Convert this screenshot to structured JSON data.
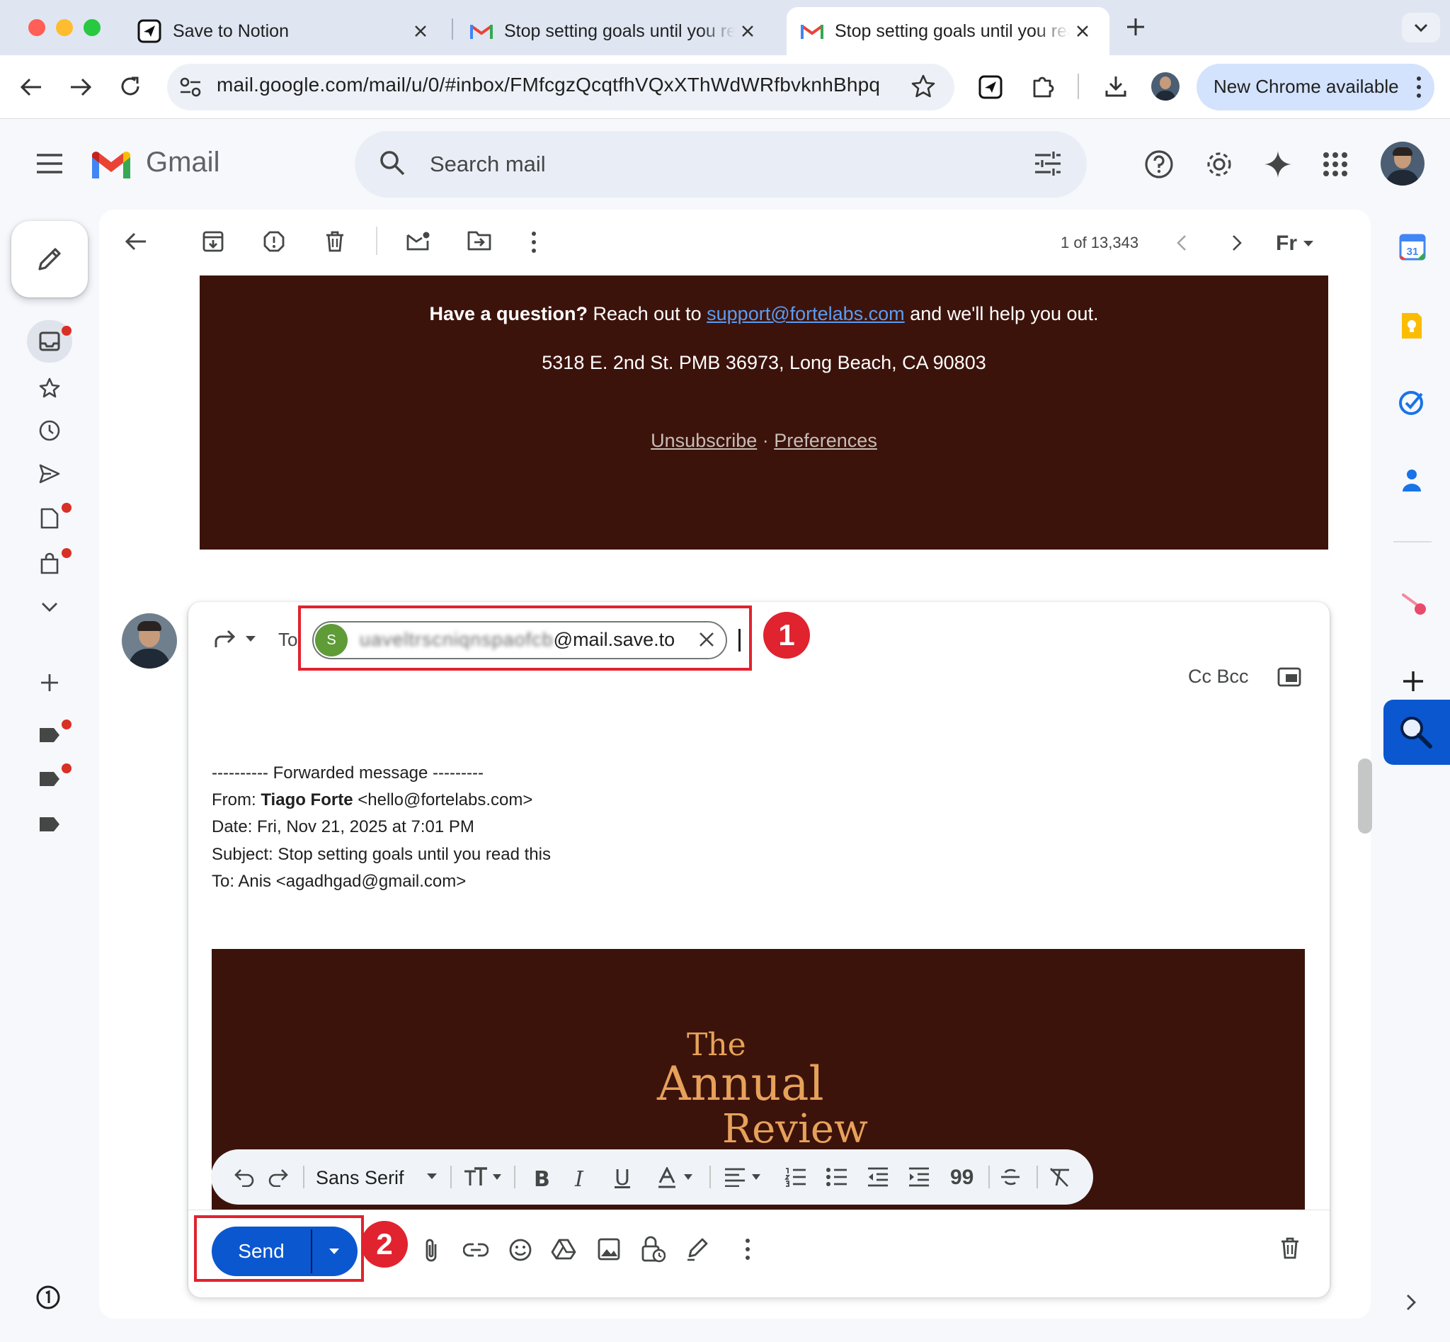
{
  "browser": {
    "tabs": [
      {
        "label": "Save to Notion",
        "active": false
      },
      {
        "label": "Stop setting goals until you read this",
        "active": false
      },
      {
        "label": "Stop setting goals until you read this",
        "active": true
      }
    ],
    "url": "mail.google.com/mail/u/0/#inbox/FMfcgzQcqtfhVQxXThWdWRfbvknhBhpq",
    "update_button": "New Chrome available",
    "colors": {
      "close": "#ff5f57",
      "minimize": "#febc2e",
      "zoom": "#28c840"
    }
  },
  "gmail": {
    "logo_text": "Gmail",
    "search_placeholder": "Search mail",
    "pagination": "1 of 13,343",
    "language_badge": "Fr"
  },
  "email_footer": {
    "question_bold": "Have a question?",
    "question_prefix": " Reach out to ",
    "support_email": "support@fortelabs.com",
    "question_suffix": " and we'll help you out.",
    "address": "5318 E. 2nd St. PMB 36973, Long Beach, CA 90803",
    "unsubscribe": "Unsubscribe",
    "separator": " · ",
    "preferences": "Preferences"
  },
  "compose": {
    "to_label": "To",
    "recipient_initial": "S",
    "recipient_blurred": "uaveltrscniqnspaofcb",
    "recipient_visible": "@mail.save.to",
    "cc_bcc": "Cc Bcc",
    "forward_header": "---------- Forwarded message ---------",
    "from_label": "From: ",
    "from_name": "Tiago Forte",
    "from_email": " <hello@fortelabs.com>",
    "date_line": "Date: Fri, Nov 21, 2025 at 7:01 PM",
    "subject_line": "Subject: Stop setting goals until you read this",
    "to_line": "To: Anis <agadhgad@gmail.com>",
    "hero_line1": "The",
    "hero_line2": "Annual",
    "hero_line3": "Review",
    "font_name": "Sans Serif",
    "send_label": "Send"
  },
  "annotations": {
    "step1": "1",
    "step2": "2",
    "color": "#e0232e"
  }
}
